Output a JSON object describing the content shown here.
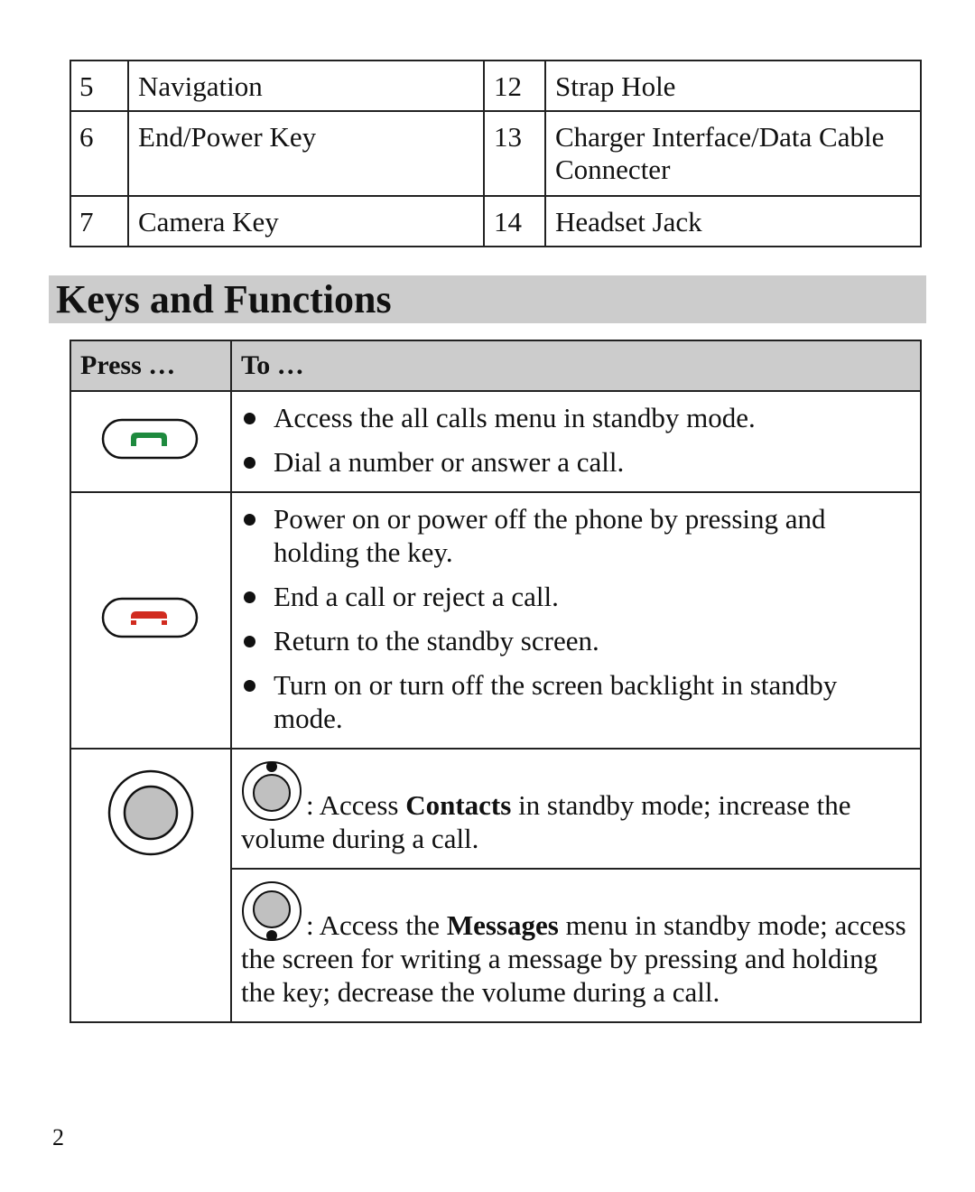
{
  "parts_table": {
    "rows": [
      {
        "left_num": "5",
        "left_label": "Navigation",
        "right_num": "12",
        "right_label": "Strap Hole"
      },
      {
        "left_num": "6",
        "left_label": "End/Power Key",
        "right_num": "13",
        "right_label": "Charger Interface/Data Cable Connecter"
      },
      {
        "left_num": "7",
        "left_label": "Camera Key",
        "right_num": "14",
        "right_label": "Headset Jack"
      }
    ]
  },
  "section": {
    "title": "Keys and Functions"
  },
  "keys_table": {
    "headers": {
      "press": "Press …",
      "to": "To …"
    },
    "rows": [
      {
        "key_icon": "call-key-icon",
        "key_color": "#1e8a3e",
        "functions": [
          "Access the all calls menu in standby mode.",
          "Dial a number or answer a call."
        ]
      },
      {
        "key_icon": "end-power-key-icon",
        "key_color": "#d12b1f",
        "functions": [
          "Power on or power off the phone by pressing and holding the key.",
          "End a call or reject a call.",
          "Return to the standby screen.",
          "Turn on or turn off the screen backlight in standby mode."
        ]
      },
      {
        "key_icon": "navigation-key-icon",
        "key_color": "#c0c0c0",
        "sub_rows": [
          {
            "icon": "navigation-up-icon",
            "prefix": ": Access ",
            "bold": "Contacts",
            "suffix": " in standby mode; increase the volume during a call."
          },
          {
            "icon": "navigation-down-icon",
            "prefix": ": Access the ",
            "bold": "Messages",
            "suffix": " menu in standby mode; access the screen for writing a message by pressing and holding the key; decrease the volume during a call."
          }
        ]
      }
    ]
  },
  "footer": {
    "page_number": "2"
  }
}
